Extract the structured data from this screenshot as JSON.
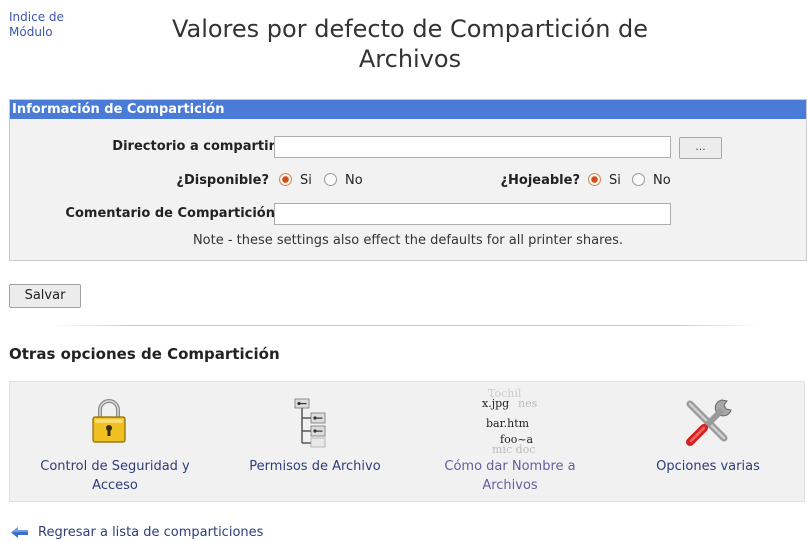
{
  "header": {
    "module_index_line1": "Indice de",
    "module_index_line2": "Módulo",
    "title_line1": "Valores por defecto de Compartición de",
    "title_line2": "Archivos"
  },
  "share_info": {
    "section_title": "Información de Compartición",
    "directory_label": "Directorio a compartir",
    "directory_value": "",
    "browse_label": "...",
    "available_label": "¿Disponible?",
    "available_yes": "Si",
    "available_no": "No",
    "available_selected": "Si",
    "browseable_label": "¿Hojeable?",
    "browseable_yes": "Si",
    "browseable_no": "No",
    "browseable_selected": "Si",
    "comment_label": "Comentario de Compartición",
    "comment_value": "",
    "note": "Note - these settings also effect the defaults for all printer shares."
  },
  "save_label": "Salvar",
  "other_options": {
    "heading": "Otras opciones de Compartición",
    "items": [
      {
        "line1": "Control de Seguridad y",
        "line2": "Acceso",
        "icon": "lock-icon"
      },
      {
        "line1": "Permisos de Archivo",
        "line2": "",
        "icon": "file-permissions-icon"
      },
      {
        "line1": "Cómo dar Nombre a",
        "line2": "Archivos",
        "icon": "file-naming-icon",
        "icon_text": {
          "a": "x.jpg",
          "a_ghost": "nes",
          "b": "bar.htm",
          "c": "foo~a",
          "c_ghost": "mic doc",
          "ghost_top": "Tochil"
        }
      },
      {
        "line1": "Opciones varias",
        "line2": "",
        "icon": "tools-icon"
      }
    ]
  },
  "back_link": "Regresar a lista de comparticiones",
  "colors": {
    "header_bar": "#4a7bd6",
    "link": "#2c3e7a",
    "visited_link": "#6a5c9e",
    "radio_on": "#d84a1a"
  }
}
